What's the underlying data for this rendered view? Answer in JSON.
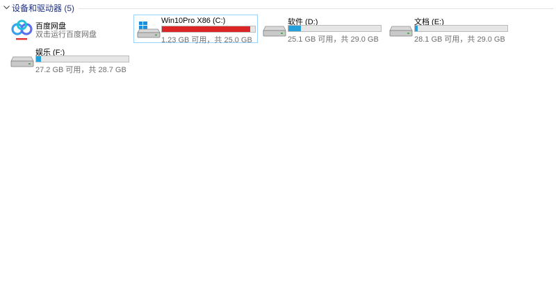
{
  "group": {
    "title": "设备和驱动器 (5)"
  },
  "items": [
    {
      "name": "百度网盘",
      "subtitle": "双击运行百度网盘",
      "icon": "baidu-netdisk-icon"
    },
    {
      "name": "Win10Pro X86 (C:)",
      "free_text": "1.23 GB 可用，共 25.0 GB",
      "used_fraction": 0.951,
      "bar_color": "#da2626",
      "icon": "windows-drive-icon",
      "selected": true
    },
    {
      "name": "软件 (D:)",
      "free_text": "25.1 GB 可用，共 29.0 GB",
      "used_fraction": 0.134,
      "bar_color": "#26a0da",
      "icon": "hard-drive-icon"
    },
    {
      "name": "文档 (E:)",
      "free_text": "28.1 GB 可用，共 29.0 GB",
      "used_fraction": 0.031,
      "bar_color": "#26a0da",
      "icon": "hard-drive-icon"
    },
    {
      "name": "娱乐 (F:)",
      "free_text": "27.2 GB 可用，共 28.7 GB",
      "used_fraction": 0.052,
      "bar_color": "#26a0da",
      "icon": "hard-drive-icon"
    }
  ]
}
